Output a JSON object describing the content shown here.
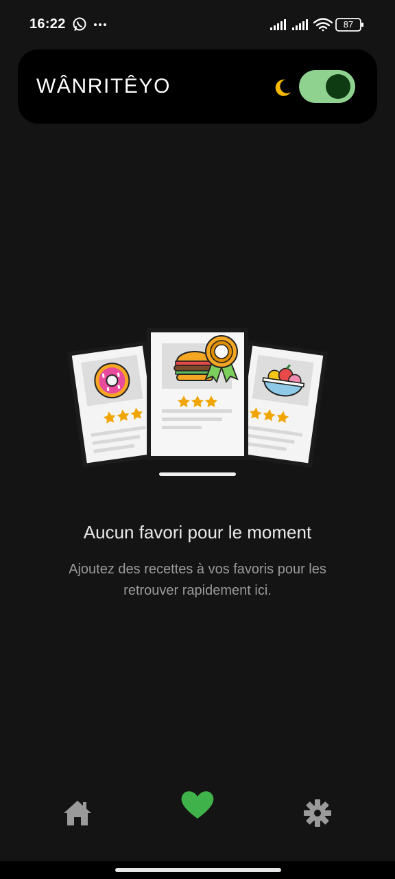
{
  "status_bar": {
    "time": "16:22",
    "battery": "87",
    "icons": [
      "whatsapp-icon",
      "more-dots-icon",
      "signal-icon",
      "signal-icon",
      "wifi-icon",
      "battery-icon"
    ]
  },
  "header": {
    "title": "WÂNRITÊYO",
    "theme_icon": "moon-icon",
    "dark_mode_enabled": true,
    "accent_color": "#8fd28f",
    "knob_color": "#0f3b12",
    "moon_color": "#f5b800"
  },
  "empty_state": {
    "illustration": [
      "donut-card",
      "burger-award-card",
      "fruit-bowl-card"
    ],
    "title": "Aucun favori pour le moment",
    "subtitle": "Ajoutez des recettes à vos favoris pour les retrouver rapidement ici."
  },
  "bottom_nav": {
    "items": [
      {
        "name": "home",
        "icon": "home-icon",
        "active": false
      },
      {
        "name": "favorites",
        "icon": "heart-icon",
        "active": true
      },
      {
        "name": "settings",
        "icon": "gear-icon",
        "active": false
      }
    ],
    "active_color": "#3fb24a",
    "inactive_color": "#9a9a9a"
  }
}
